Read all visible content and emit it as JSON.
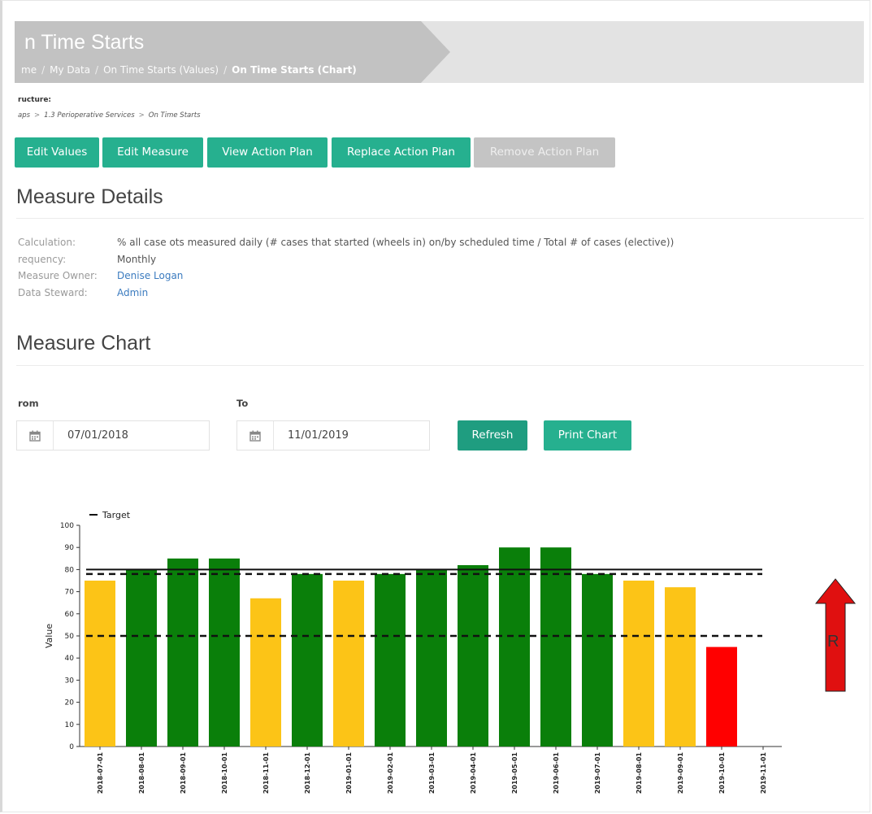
{
  "header": {
    "title": "n Time Starts",
    "breadcrumbs": [
      "me",
      "My Data",
      "On Time Starts (Values)",
      "On Time Starts (Chart)"
    ],
    "separator": "/"
  },
  "structure": {
    "label": "ructure:",
    "path": [
      "aps",
      "1.3 Perioperative Services",
      "On Time Starts"
    ],
    "separator": ">"
  },
  "toolbar": {
    "edit_values": "Edit Values",
    "edit_measure": "Edit Measure",
    "view_action_plan": "View Action Plan",
    "replace_action_plan": "Replace Action Plan",
    "remove_action_plan": "Remove Action Plan"
  },
  "details": {
    "heading": "Measure Details",
    "calculation_label": "Calculation:",
    "calculation_value": "% all case ots measured daily (# cases that started (wheels in) on/by scheduled time / Total # of cases (elective))",
    "frequency_label": "requency:",
    "frequency_value": "Monthly",
    "owner_label": "Measure Owner:",
    "owner_value": "Denise Logan",
    "steward_label": "Data Steward:",
    "steward_value": "Admin"
  },
  "chart_section": {
    "heading": "Measure Chart",
    "from_label": "rom",
    "to_label": "To",
    "from_value": "07/01/2018",
    "to_value": "11/01/2019",
    "refresh_label": "Refresh",
    "print_label": "Print Chart",
    "calendar_icon": "calendar-icon"
  },
  "colors": {
    "accent": "#26b08f",
    "accent_dark": "#1f9d80",
    "disabled": "#c4c4c4",
    "green": "#0a7f0a",
    "yellow": "#fcc417",
    "red": "#ff0000"
  },
  "chart_data": {
    "type": "bar",
    "legend": {
      "entries": [
        "Target"
      ],
      "placement": "top-left"
    },
    "ylabel": "Value",
    "ylim": [
      0,
      100
    ],
    "yticks": [
      0,
      10,
      20,
      30,
      40,
      50,
      60,
      70,
      80,
      90,
      100
    ],
    "categories": [
      "2018-07-01",
      "2018-08-01",
      "2018-09-01",
      "2018-10-01",
      "2018-11-01",
      "2018-12-01",
      "2019-01-01",
      "2019-02-01",
      "2019-03-01",
      "2019-04-01",
      "2019-05-01",
      "2019-06-01",
      "2019-07-01",
      "2019-08-01",
      "2019-09-01",
      "2019-10-01",
      "2019-11-01"
    ],
    "values": [
      75,
      80,
      85,
      85,
      67,
      78,
      75,
      78,
      80,
      82,
      90,
      90,
      78,
      75,
      72,
      45,
      null
    ],
    "bar_status": [
      "yellow",
      "green",
      "green",
      "green",
      "yellow",
      "green",
      "yellow",
      "green",
      "green",
      "green",
      "green",
      "green",
      "green",
      "yellow",
      "yellow",
      "red",
      null
    ],
    "target": 80,
    "thresholds": [
      78,
      50
    ],
    "direction_indicator": {
      "icon": "up-arrow-icon",
      "text": "R"
    }
  }
}
